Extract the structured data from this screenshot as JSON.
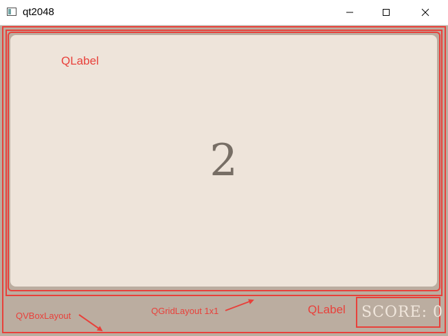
{
  "window": {
    "title": "qt2048",
    "icon": "app-window-icon",
    "controls": {
      "minimize_icon": "minimize-icon",
      "maximize_icon": "maximize-icon",
      "close_icon": "close-icon"
    }
  },
  "board": {
    "tile_value": "2",
    "tile_color": "#eee4da",
    "tile_text_color": "#776e65",
    "background_color": "#bbada0"
  },
  "score": {
    "text": "SCORE: 0",
    "text_color": "#f0e6dc"
  },
  "annotations": {
    "qlabel_top": "QLabel",
    "qlabel_bottom": "QLabel",
    "grid_layout": "QGridLayout 1x1",
    "vbox_layout": "QVBoxLayout",
    "color": "#e8403a"
  }
}
